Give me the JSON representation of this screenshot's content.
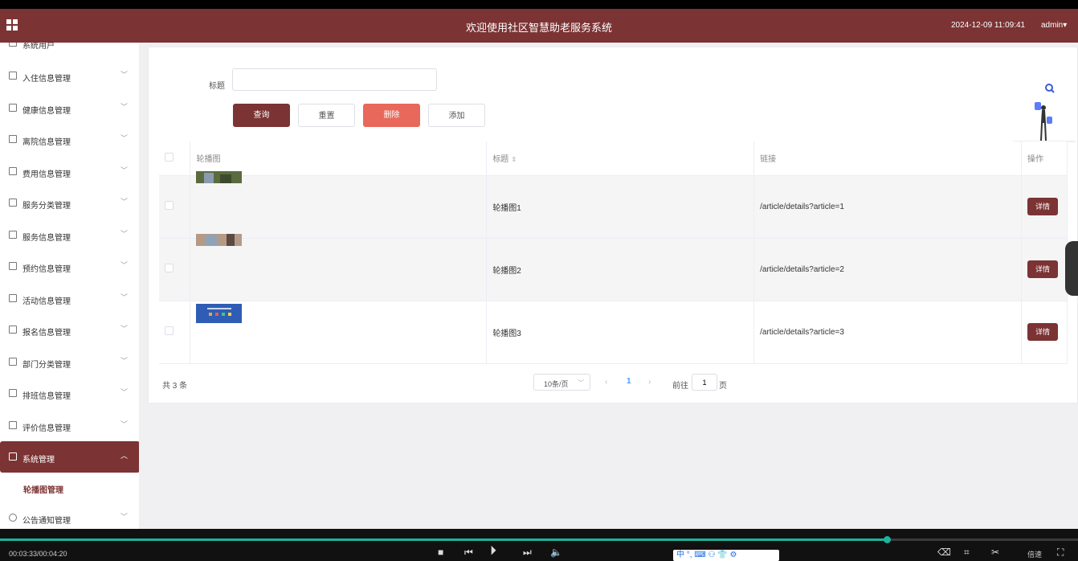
{
  "header": {
    "title": "欢迎使用社区智慧助老服务系统",
    "datetime": "2024-12-09 11:09:41",
    "user": "admin"
  },
  "sidebar": {
    "items": [
      {
        "label": "系统用户"
      },
      {
        "label": "入住信息管理"
      },
      {
        "label": "健康信息管理"
      },
      {
        "label": "离院信息管理"
      },
      {
        "label": "费用信息管理"
      },
      {
        "label": "服务分类管理"
      },
      {
        "label": "服务信息管理"
      },
      {
        "label": "预约信息管理"
      },
      {
        "label": "活动信息管理"
      },
      {
        "label": "报名信息管理"
      },
      {
        "label": "部门分类管理"
      },
      {
        "label": "排班信息管理"
      },
      {
        "label": "评价信息管理"
      },
      {
        "label": "系统管理"
      },
      {
        "label": "公告通知管理"
      }
    ],
    "active_sub": "轮播图管理"
  },
  "search": {
    "label": "标题",
    "value": ""
  },
  "buttons": {
    "query": "查询",
    "reset": "重置",
    "delete": "删除",
    "add": "添加"
  },
  "table": {
    "headers": [
      "轮播图",
      "标题",
      "链接",
      "操作"
    ],
    "rows": [
      {
        "title": "轮播图1",
        "link": "/article/details?article=1",
        "action": "详情"
      },
      {
        "title": "轮播图2",
        "link": "/article/details?article=2",
        "action": "详情"
      },
      {
        "title": "轮播图3",
        "link": "/article/details?article=3",
        "action": "详情"
      }
    ]
  },
  "pagination": {
    "total": "共 3 条",
    "page_size": "10条/页",
    "current_page": "1",
    "goto_label": "前往",
    "goto_value": "1",
    "goto_unit": "页"
  },
  "player": {
    "time": "00:03:33/00:04:20",
    "progress": 0.823,
    "ime": "中 °, ⌨ ⚇ 👕 ⚙",
    "speed": "倍速"
  },
  "colors": {
    "brand": "#7b3334",
    "danger": "#e8685b",
    "progress": "#1db39a"
  }
}
